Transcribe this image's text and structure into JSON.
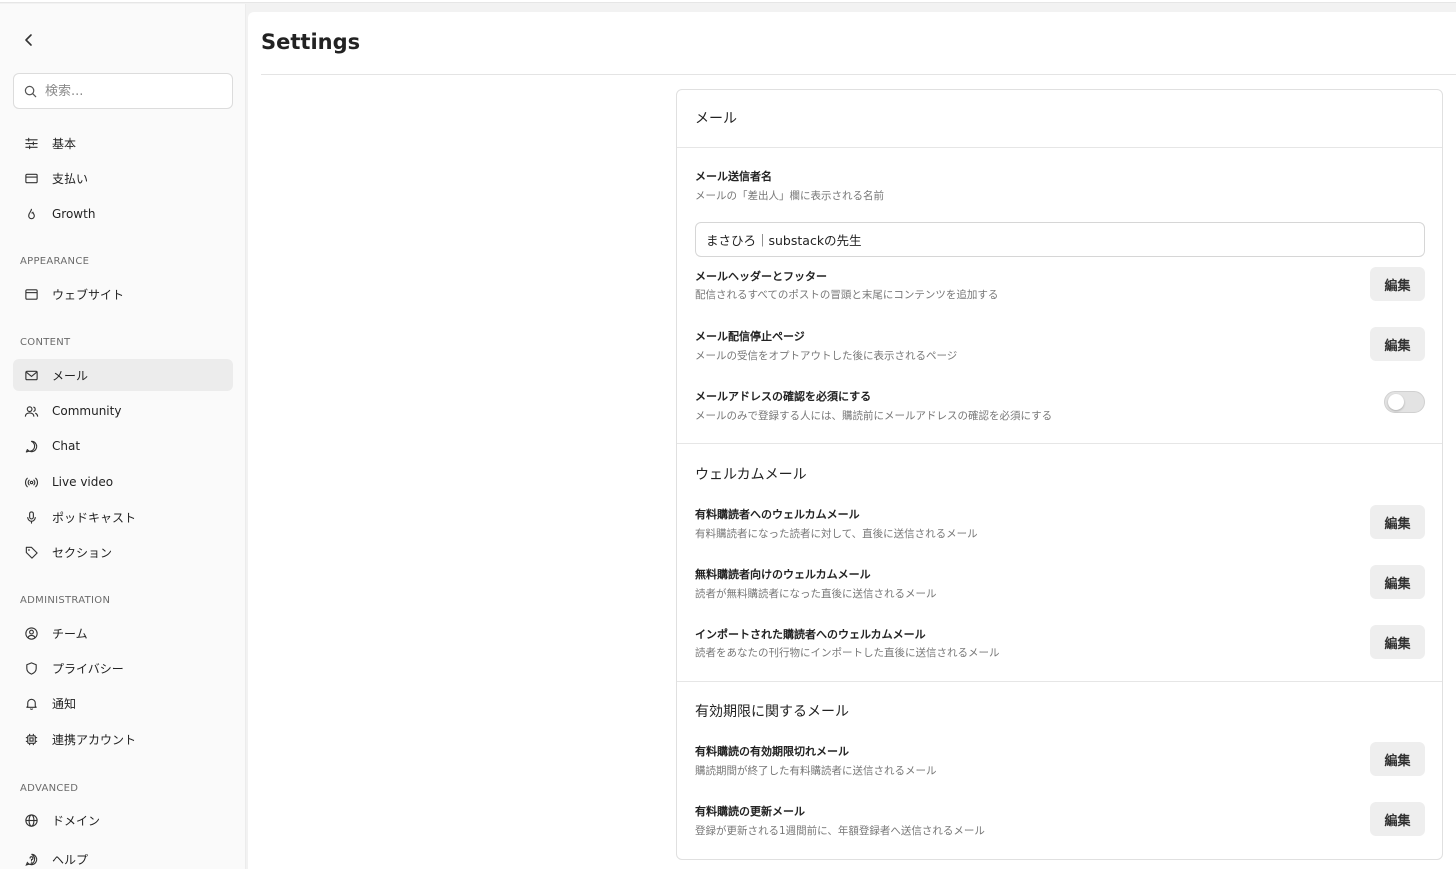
{
  "page": {
    "title": "Settings"
  },
  "sidebar": {
    "search_placeholder": "検索...",
    "items_top": [
      {
        "label": "基本",
        "icon": "sliders-icon"
      },
      {
        "label": "支払い",
        "icon": "credit-card-icon"
      },
      {
        "label": "Growth",
        "icon": "flame-icon"
      }
    ],
    "sections": {
      "appearance": "APPEARANCE",
      "content": "CONTENT",
      "administration": "ADMINISTRATION",
      "advanced": "ADVANCED"
    },
    "appearance_items": [
      {
        "label": "ウェブサイト",
        "icon": "browser-window-icon"
      }
    ],
    "content_items": [
      {
        "label": "メール",
        "icon": "mail-icon",
        "active": true
      },
      {
        "label": "Community",
        "icon": "users-icon"
      },
      {
        "label": "Chat",
        "icon": "chat-bubble-icon"
      },
      {
        "label": "Live video",
        "icon": "broadcast-icon"
      },
      {
        "label": "ポッドキャスト",
        "icon": "microphone-icon"
      },
      {
        "label": "セクション",
        "icon": "tag-icon"
      }
    ],
    "administration_items": [
      {
        "label": "チーム",
        "icon": "user-circle-icon"
      },
      {
        "label": "プライバシー",
        "icon": "shield-icon"
      },
      {
        "label": "通知",
        "icon": "bell-icon"
      },
      {
        "label": "連携アカウント",
        "icon": "chip-icon"
      }
    ],
    "advanced_items": [
      {
        "label": "ドメイン",
        "icon": "globe-icon"
      },
      {
        "label": "ヘルプ",
        "icon": "help-icon"
      }
    ]
  },
  "email_card": {
    "section_mail": "メール",
    "sender_name_title": "メール送信者名",
    "sender_name_desc": "メールの「差出人」欄に表示される名前",
    "sender_name_value": "まさひろ｜substackの先生",
    "header_footer_title": "メールヘッダーとフッター",
    "header_footer_desc": "配信されるすべてのポストの冒頭と末尾にコンテンツを追加する",
    "unsubscribe_title": "メール配信停止ページ",
    "unsubscribe_desc": "メールの受信をオプトアウトした後に表示されるページ",
    "verify_title": "メールアドレスの確認を必須にする",
    "verify_desc": "メールのみで登録する人には、購読前にメールアドレスの確認を必須にする",
    "verify_enabled": false,
    "section_welcome": "ウェルカムメール",
    "paid_welcome_title": "有料購読者へのウェルカムメール",
    "paid_welcome_desc": "有料購読者になった読者に対して、直後に送信されるメール",
    "free_welcome_title": "無料購読者向けのウェルカムメール",
    "free_welcome_desc": "読者が無料購読者になった直後に送信されるメール",
    "import_welcome_title": "インポートされた購読者へのウェルカムメール",
    "import_welcome_desc": "読者をあなたの刊行物にインポートした直後に送信されるメール",
    "section_expiry": "有効期限に関するメール",
    "expired_title": "有料購読の有効期限切れメール",
    "expired_desc": "購読期間が終了した有料購読者に送信されるメール",
    "renewal_title": "有料購読の更新メール",
    "renewal_desc": "登録が更新される1週間前に、年額登録者へ送信されるメール",
    "edit_label": "編集"
  }
}
